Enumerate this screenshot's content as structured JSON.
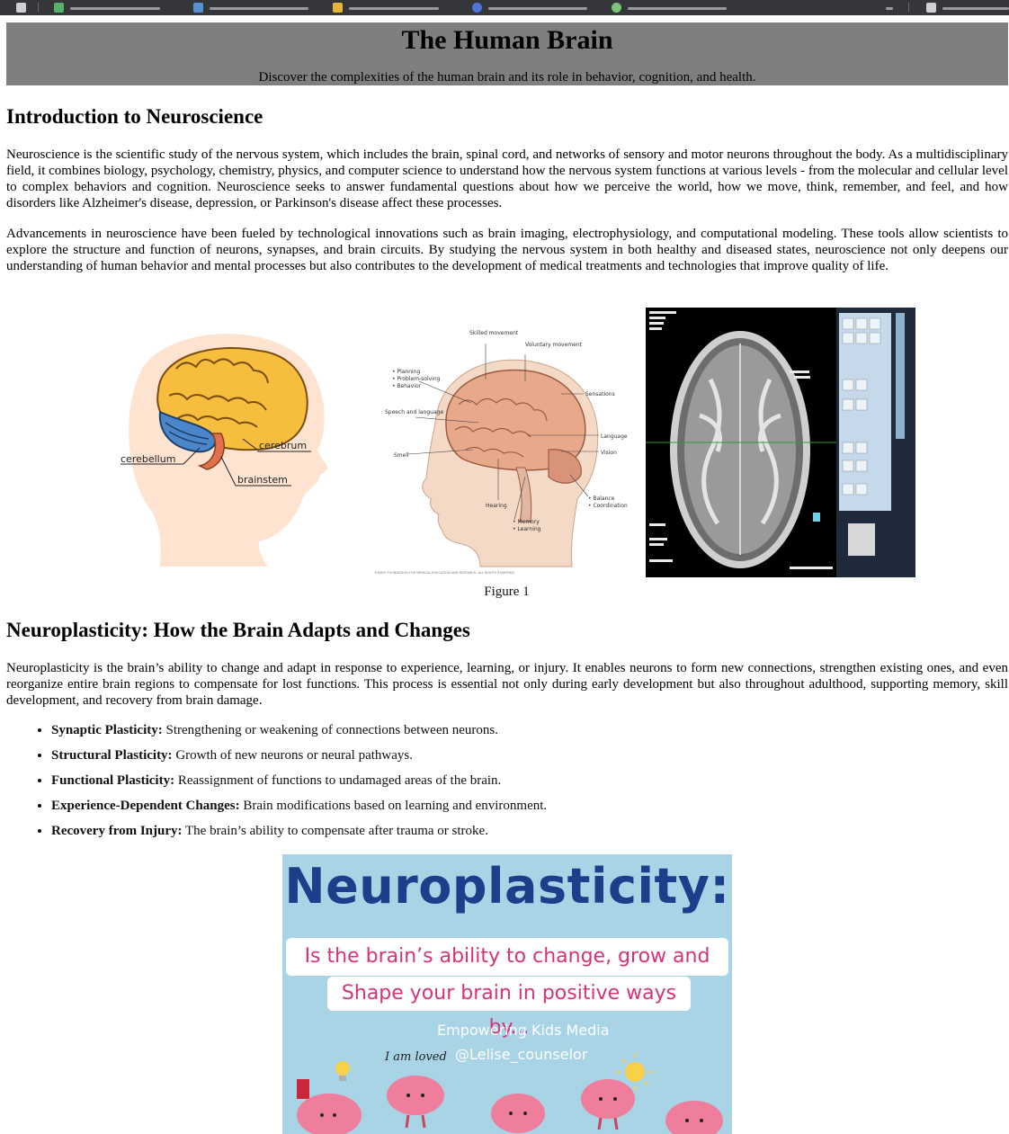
{
  "header": {
    "title": "The Human Brain",
    "subtitle": "Discover the complexities of the human brain and its role in behavior, cognition, and health."
  },
  "intro": {
    "heading": "Introduction to Neuroscience",
    "p1": "Neuroscience is the scientific study of the nervous system, which includes the brain, spinal cord, and networks of sensory and motor neurons throughout the body. As a multidisciplinary field, it combines biology, psychology, chemistry, physics, and computer science to understand how the nervous system functions at various levels - from the molecular and cellular level to complex behaviors and cognition. Neuroscience seeks to answer fundamental questions about how we perceive the world, how we move, think, remember, and feel, and how disorders like Alzheimer's disease, depression, or Parkinson's disease affect these processes.",
    "p2": "Advancements in neuroscience have been fueled by technological innovations such as brain imaging, electrophysiology, and computational modeling. These tools allow scientists to explore the structure and function of neurons, synapses, and brain circuits. By studying the nervous system in both healthy and diseased states, neuroscience not only deepens our understanding of human behavior and mental processes but also contributes to the development of medical treatments and technologies that improve quality of life."
  },
  "figure1": {
    "caption": "Figure 1",
    "diagram_a": {
      "labels": [
        "cerebrum",
        "cerebellum",
        "brainstem"
      ]
    },
    "diagram_b": {
      "labels": {
        "skilled": "Skilled movement",
        "voluntary": "Voluntary movement",
        "planning": "• Planning",
        "problem": "• Problem-solving",
        "behavior": "• Behavior",
        "sensations": "Sensations",
        "speech": "Speech and language",
        "language": "Language",
        "smell": "Smell",
        "vision": "Vision",
        "hearing": "Hearing",
        "balance": "• Balance",
        "coordination": "• Coordination",
        "memory": "• Memory",
        "learning": "• Learning"
      },
      "copyright": "©MAYO FOUNDATION FOR MEDICAL EDUCATION AND RESEARCH. ALL RIGHTS RESERVED."
    }
  },
  "neuro": {
    "heading": "Neuroplasticity: How the Brain Adapts and Changes",
    "p1": "Neuroplasticity is the brain’s ability to change and adapt in response to experience, learning, or injury. It enables neurons to form new connections, strengthen existing ones, and even reorganize entire brain regions to compensate for lost functions. This process is essential not only during early development but also throughout adulthood, supporting memory, skill development, and recovery from brain damage.",
    "items": [
      {
        "term": "Synaptic Plasticity:",
        "desc": " Strengthening or weakening of connections between neurons."
      },
      {
        "term": "Structural Plasticity:",
        "desc": " Growth of new neurons or neural pathways."
      },
      {
        "term": "Functional Plasticity:",
        "desc": " Reassignment of functions to undamaged areas of the brain."
      },
      {
        "term": "Experience-Dependent Changes:",
        "desc": " Brain modifications based on learning and environment."
      },
      {
        "term": "Recovery from Injury:",
        "desc": " The brain’s ability to compensate after trauma or stroke."
      }
    ]
  },
  "poster": {
    "title": "Neuroplasticity:",
    "line1": "Is the brain’s ability to change, grow and adapt.",
    "line2": "Shape your brain in positive ways by...",
    "org": "Empowering Kids Media",
    "handle": "@Lelise_counselor",
    "hand": "I am loved"
  },
  "colors": {
    "header_bg": "#7f7f7f",
    "poster_bg": "#a8d4e6",
    "poster_title": "#1b3f8b",
    "poster_pink": "#d6337a"
  }
}
